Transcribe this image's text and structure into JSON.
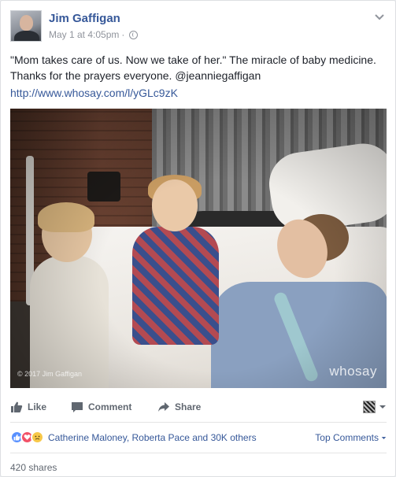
{
  "post": {
    "author": "Jim Gaffigan",
    "timestamp": "May 1 at 4:05pm",
    "separator": "·",
    "privacy_icon": "globe-icon",
    "menu_icon": "chevron-down-icon",
    "text": "\"Mom takes care of us. Now we take of her.\" The miracle of baby medicine. Thanks for the prayers everyone. @jeanniegaffigan",
    "link": "http://www.whosay.com/l/yGLc9zK"
  },
  "media": {
    "copyright": "© 2017 Jim Gaffigan",
    "watermark": "whosay"
  },
  "actions": {
    "like": "Like",
    "comment": "Comment",
    "share": "Share"
  },
  "reactions": {
    "icons": [
      "like-reaction-icon",
      "love-reaction-icon",
      "sad-reaction-icon"
    ],
    "summary": "Catherine Maloney, Roberta Pace and 30K others",
    "top_comments": "Top Comments"
  },
  "shares": "420 shares",
  "colors": {
    "link_blue": "#365899",
    "meta_gray": "#90949c",
    "action_gray": "#606770",
    "like_blue": "#5890ff",
    "love_red": "#f25268",
    "sad_yellow": "#f7c849"
  }
}
